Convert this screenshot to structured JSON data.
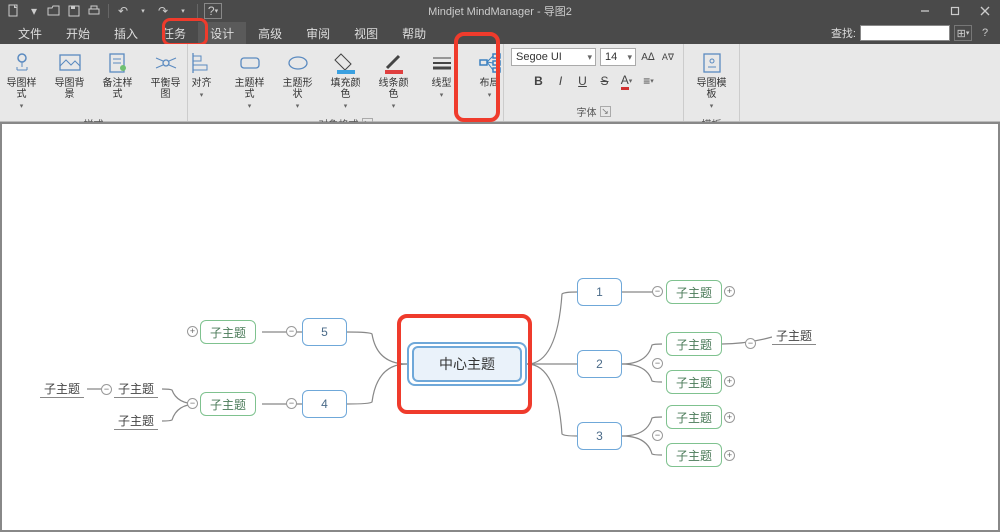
{
  "titlebar": {
    "title": "Mindjet MindManager - 导图2"
  },
  "menubar": {
    "items": [
      "文件",
      "开始",
      "插入",
      "任务",
      "设计",
      "高级",
      "审阅",
      "视图",
      "帮助"
    ],
    "active_index": 4,
    "find_label": "查找:"
  },
  "ribbon": {
    "groups": [
      {
        "label": "样式",
        "items": [
          {
            "label": "导图样式"
          },
          {
            "label": "导图背景"
          },
          {
            "label": "备注样式"
          },
          {
            "label": "平衡导图"
          }
        ]
      },
      {
        "label": "对象格式",
        "items": [
          {
            "label": "对齐"
          },
          {
            "label": "主题样式"
          },
          {
            "label": "主题形状"
          },
          {
            "label": "填充颜色"
          },
          {
            "label": "线条颜色"
          },
          {
            "label": "线型"
          },
          {
            "label": "布局"
          }
        ]
      },
      {
        "label": "字体",
        "font_name": "Segoe UI",
        "font_size": "14",
        "tools": [
          "B",
          "I",
          "U",
          "S",
          "A",
          "≡"
        ],
        "aa": [
          "Aᐃ",
          "Aᐁ"
        ]
      },
      {
        "label": "模板",
        "items": [
          {
            "label": "导图模板"
          }
        ]
      }
    ]
  },
  "map": {
    "center": "中心主题",
    "left_branches": [
      "5",
      "4"
    ],
    "right_branches": [
      "1",
      "2",
      "3"
    ],
    "subtopic": "子主题"
  },
  "highlights": {
    "tab": "设计",
    "button": "布局",
    "center": "中心主题"
  }
}
